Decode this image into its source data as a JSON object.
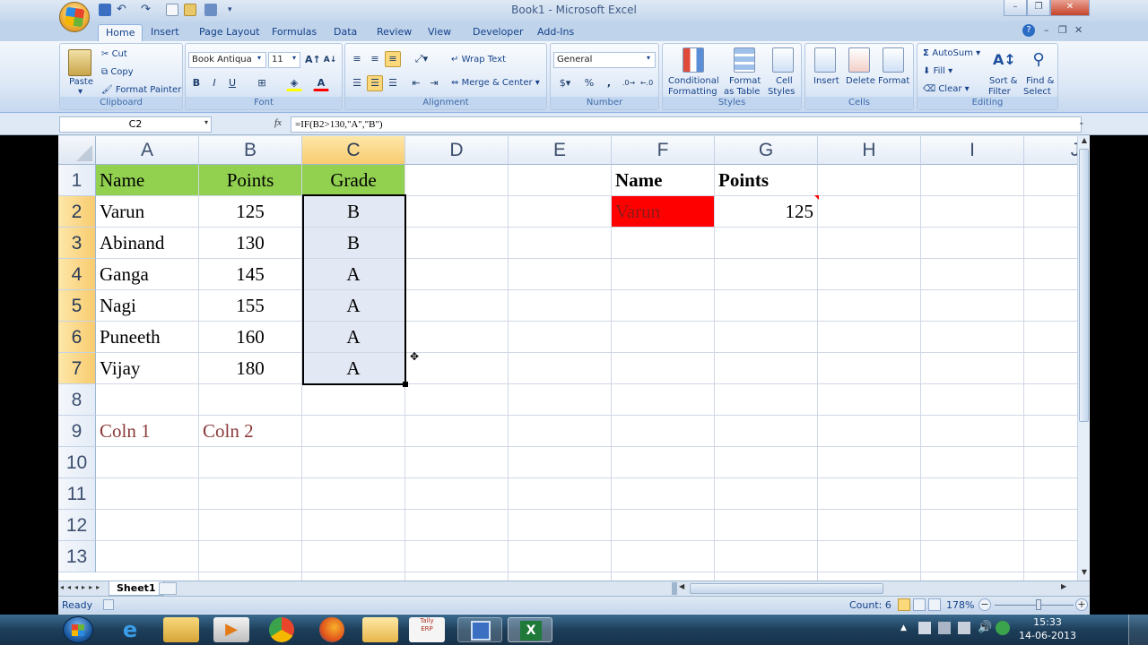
{
  "window": {
    "title": "Book1 - Microsoft Excel",
    "minimize": "–",
    "restore": "❐",
    "close": "✕"
  },
  "tabs": [
    "Home",
    "Insert",
    "Page Layout",
    "Formulas",
    "Data",
    "Review",
    "View",
    "Developer",
    "Add-Ins"
  ],
  "ribbon": {
    "clipboard": {
      "label": "Clipboard",
      "paste": "Paste",
      "cut": "Cut",
      "copy": "Copy",
      "format_painter": "Format Painter"
    },
    "font": {
      "label": "Font",
      "font_name": "Book Antiqua",
      "font_size": "11",
      "bold": "B",
      "italic": "I",
      "underline": "U"
    },
    "alignment": {
      "label": "Alignment",
      "wrap_text": "Wrap Text",
      "merge_center": "Merge & Center"
    },
    "number": {
      "label": "Number",
      "format": "General",
      "percent": "%",
      "comma": ","
    },
    "styles": {
      "label": "Styles",
      "conditional": "Conditional",
      "conditional2": "Formatting",
      "format_as": "Format",
      "format_as2": "as Table",
      "cell": "Cell",
      "cell2": "Styles"
    },
    "cells": {
      "label": "Cells",
      "insert": "Insert",
      "delete": "Delete",
      "format": "Format"
    },
    "editing": {
      "label": "Editing",
      "autosum": "AutoSum",
      "fill": "Fill",
      "clear": "Clear",
      "sort": "Sort &",
      "sort2": "Filter",
      "find": "Find &",
      "find2": "Select"
    }
  },
  "formula_bar": {
    "name_box": "C2",
    "fx": "fx",
    "formula": "=IF(B2>130,\"A\",\"B\")"
  },
  "columns": [
    "A",
    "B",
    "C",
    "D",
    "E",
    "F",
    "G",
    "H",
    "I",
    "J"
  ],
  "rows": [
    "1",
    "2",
    "3",
    "4",
    "5",
    "6",
    "7",
    "8",
    "9",
    "10",
    "11",
    "12",
    "13"
  ],
  "cells": {
    "A1": "Name",
    "B1": "Points",
    "C1": "Grade",
    "A2": "Varun",
    "B2": "125",
    "C2": "B",
    "A3": "Abinand",
    "B3": "130",
    "C3": "B",
    "A4": "Ganga",
    "B4": "145",
    "C4": "A",
    "A5": "Nagi",
    "B5": "155",
    "C5": "A",
    "A6": "Puneeth",
    "B6": "160",
    "C6": "A",
    "A7": "Vijay",
    "B7": "180",
    "C7": "A",
    "A9": "Coln 1",
    "B9": "Coln 2",
    "F1": "Name",
    "G1": "Points",
    "F2": "Varun",
    "G2": "125"
  },
  "colors": {
    "header_fill": "#92d050",
    "selection_fill": "#e3e9f4",
    "lookup_fill": "#ff0000",
    "coln_text": "#8b3a3a"
  },
  "sheet_tabs": [
    "Sheet1"
  ],
  "status": {
    "mode": "Ready",
    "count": "Count: 6",
    "zoom": "178%"
  },
  "taskbar": {
    "time": "15:33",
    "date": "14-06-2013"
  }
}
